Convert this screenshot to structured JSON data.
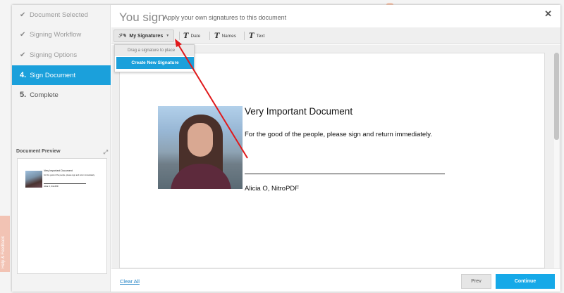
{
  "header": {
    "title": "You sign",
    "subtitle": "Apply your own signatures to this document",
    "close_symbol": "✕"
  },
  "sidebar": {
    "steps": [
      {
        "label": "Document Selected",
        "state": "done"
      },
      {
        "label": "Signing Workflow",
        "state": "done"
      },
      {
        "label": "Signing Options",
        "state": "done"
      },
      {
        "number": "4.",
        "label": "Sign Document",
        "state": "active"
      },
      {
        "number": "5.",
        "label": "Complete",
        "state": "pending"
      }
    ],
    "preview": {
      "label": "Document Preview",
      "expand_icon": "expand-icon",
      "mini_title": "Very Important Document",
      "mini_line": "For the good of the people, please sign and return immediately.",
      "mini_name": "Alicia O, NitroPDF"
    }
  },
  "toolbar": {
    "signatures_label": "My Signatures",
    "date_label": "Date",
    "names_label": "Names",
    "text_label": "Text"
  },
  "dropdown": {
    "hint": "Drag a signature to place",
    "create_label": "Create New Signature"
  },
  "document": {
    "title": "Very Important Document",
    "line": "For the good of the people, please sign and return immediately.",
    "name": "Alicia O, NitroPDF"
  },
  "footer": {
    "clear_all": "Clear All",
    "prev": "Prev",
    "continue": "Continue"
  },
  "feedback": {
    "label": "Help & Feedback"
  },
  "colors": {
    "accent": "#1ba0db",
    "continue": "#16a9e8",
    "annotation_arrow": "#e0191b"
  }
}
